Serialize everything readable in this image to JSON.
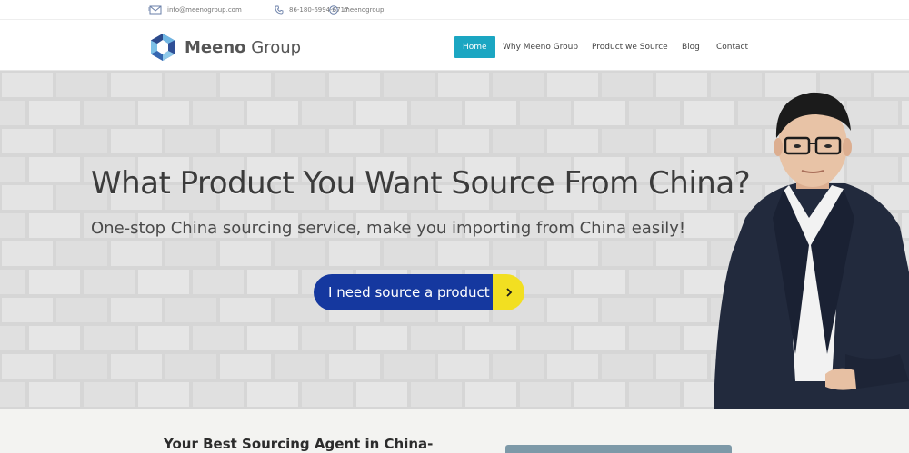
{
  "topbar": {
    "email": "info@meenogroup.com",
    "phone": "86-180-6994-6717",
    "skype": "meenogroup",
    "icons": [
      "email-icon",
      "phone-icon",
      "skype-icon"
    ]
  },
  "header": {
    "brand_bold": "Meeno",
    "brand_light": "Group",
    "nav": {
      "home": "Home",
      "why": "Why Meeno Group",
      "product": "Product we Source",
      "blog": "Blog",
      "contact": "Contact"
    },
    "active_color": "#1ba6c2"
  },
  "hero": {
    "title": "What Product You Want Source From China?",
    "subtitle": "One-stop China sourcing service, make you importing from China easily!",
    "cta_label": "I need source a product",
    "cta_color": "#15389f",
    "cta_arrow_color": "#f2df21"
  },
  "lower": {
    "tagline": "Your Best Sourcing Agent in China-"
  }
}
